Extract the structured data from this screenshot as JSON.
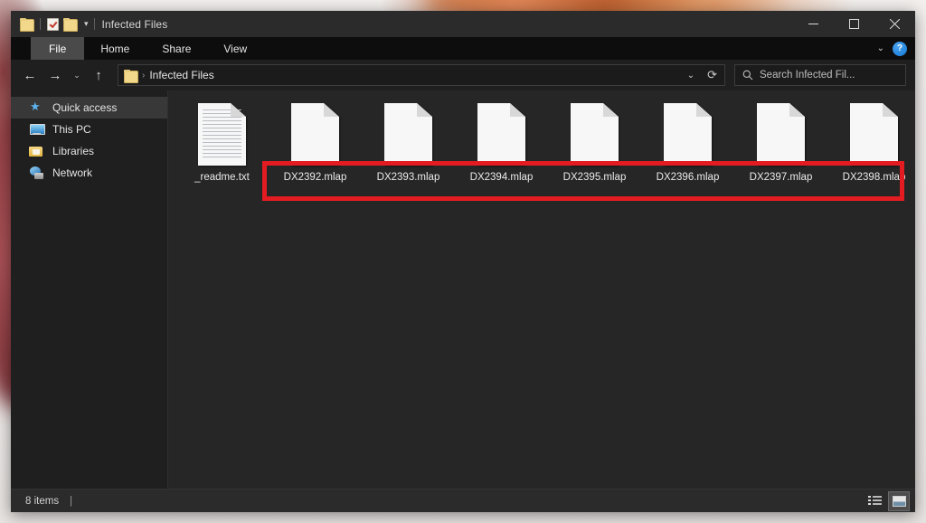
{
  "window": {
    "title": "Infected Files",
    "quick_access_toolbar": [
      {
        "icon": "folder-icon",
        "name": "folder-properties-quick-button"
      },
      {
        "icon": "properties-icon",
        "name": "properties-quick-button"
      },
      {
        "icon": "folder-icon",
        "name": "new-folder-quick-button"
      },
      {
        "icon": "chevron-down-icon",
        "name": "customize-quick-access-toolbar"
      }
    ],
    "caption": {
      "minimize": "minimize-button",
      "maximize": "maximize-button",
      "close": "close-button"
    }
  },
  "ribbon": {
    "tabs": [
      {
        "label": "File",
        "selected": true
      },
      {
        "label": "Home",
        "selected": false
      },
      {
        "label": "Share",
        "selected": false
      },
      {
        "label": "View",
        "selected": false
      }
    ],
    "collapse_icon": "chevron-down-icon",
    "help_label": "?"
  },
  "address_bar": {
    "back_icon": "back-arrow-icon",
    "forward_icon": "forward-arrow-icon",
    "recent_icon": "chevron-down-icon",
    "up_icon": "up-arrow-icon",
    "breadcrumb": [
      {
        "icon": "folder-icon",
        "label": ""
      },
      {
        "label": "Infected Files"
      }
    ],
    "crumb_separator": "›",
    "history_icon": "chevron-down-icon",
    "refresh_icon": "refresh-icon"
  },
  "search": {
    "icon": "search-icon",
    "placeholder": "Search Infected Fil..."
  },
  "navigation_pane": {
    "items": [
      {
        "label": "Quick access",
        "icon": "pin-icon",
        "selected": true
      },
      {
        "label": "This PC",
        "icon": "computer-icon",
        "selected": false
      },
      {
        "label": "Libraries",
        "icon": "libraries-folder-icon",
        "selected": false
      },
      {
        "label": "Network",
        "icon": "network-icon",
        "selected": false
      }
    ]
  },
  "file_list": {
    "items": [
      {
        "name": "_readme.txt",
        "icon": "text-document-icon",
        "encrypted": false
      },
      {
        "name": "DX2392.mlap",
        "icon": "blank-document-icon",
        "encrypted": true
      },
      {
        "name": "DX2393.mlap",
        "icon": "blank-document-icon",
        "encrypted": true
      },
      {
        "name": "DX2394.mlap",
        "icon": "blank-document-icon",
        "encrypted": true
      },
      {
        "name": "DX2395.mlap",
        "icon": "blank-document-icon",
        "encrypted": true
      },
      {
        "name": "DX2396.mlap",
        "icon": "blank-document-icon",
        "encrypted": true
      },
      {
        "name": "DX2397.mlap",
        "icon": "blank-document-icon",
        "encrypted": true
      },
      {
        "name": "DX2398.mlap",
        "icon": "blank-document-icon",
        "encrypted": true
      }
    ]
  },
  "annotation": {
    "color": "#e21c21",
    "name": "red-highlight-rectangle"
  },
  "status_bar": {
    "item_count": "8 items",
    "separator": "|",
    "view_details_icon": "details-view-icon",
    "view_large_icons_icon": "large-icons-view-icon",
    "active_view": "large-icons"
  }
}
